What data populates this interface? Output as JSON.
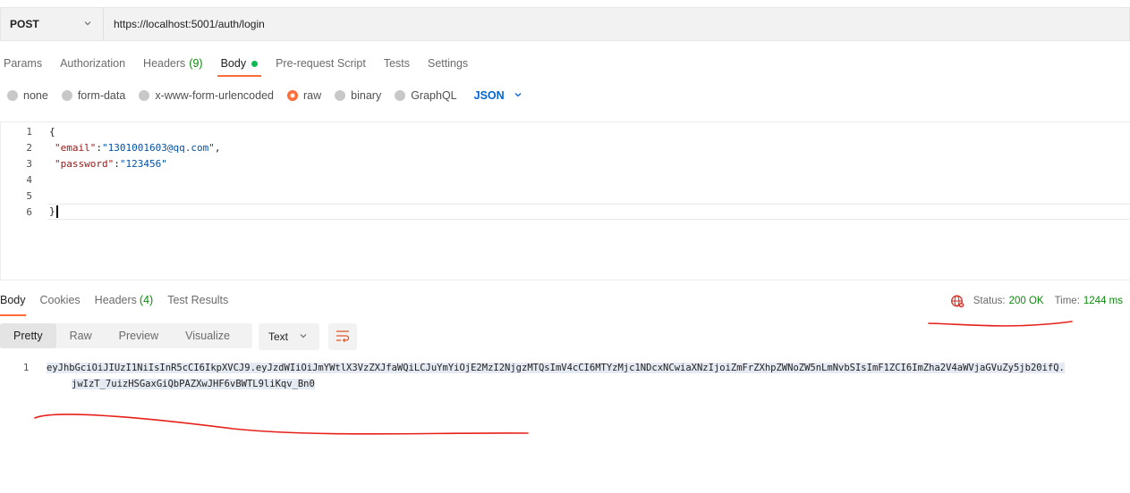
{
  "request": {
    "method": "POST",
    "url": "https://localhost:5001/auth/login"
  },
  "request_tabs": [
    {
      "label": "Params"
    },
    {
      "label": "Authorization"
    },
    {
      "label": "Headers",
      "count": "(9)"
    },
    {
      "label": "Body"
    },
    {
      "label": "Pre-request Script"
    },
    {
      "label": "Tests"
    },
    {
      "label": "Settings"
    }
  ],
  "body_types": [
    {
      "label": "none"
    },
    {
      "label": "form-data"
    },
    {
      "label": "x-www-form-urlencoded"
    },
    {
      "label": "raw"
    },
    {
      "label": "binary"
    },
    {
      "label": "GraphQL"
    }
  ],
  "body_format": "JSON",
  "editor": {
    "line_numbers": [
      "1",
      "2",
      "3",
      "4",
      "5",
      "6"
    ],
    "line1": "{",
    "email_key": "\"email\"",
    "email_colon": ":",
    "email_val": "\"1301001603@qq.com\"",
    "email_comma": ",",
    "password_key": "\"password\"",
    "password_colon": ":",
    "password_val": "\"123456\"",
    "line6": "}"
  },
  "response_tabs": [
    {
      "label": "Body"
    },
    {
      "label": "Cookies"
    },
    {
      "label": "Headers",
      "count": "(4)"
    },
    {
      "label": "Test Results"
    }
  ],
  "status": {
    "status_label": "Status:",
    "status_value": "200 OK",
    "time_label": "Time:",
    "time_value": "1244 ms"
  },
  "view_modes": [
    {
      "label": "Pretty"
    },
    {
      "label": "Raw"
    },
    {
      "label": "Preview"
    },
    {
      "label": "Visualize"
    }
  ],
  "response_format": "Text",
  "response": {
    "line_number": "1",
    "token_line1": "eyJhbGciOiJIUzI1NiIsInR5cCI6IkpXVCJ9.eyJzdWIiOiJmYWtlX3VzZXJfaWQiLCJuYmYiOjE2MzI2NjgzMTQsImV4cCI6MTYzMjc1NDcxNCwiaXNzIjoiZmFrZXhpZWNoZW5nLmNvbSIsImF1ZCI6ImZha2V4aWVjaGVuZy5jb20ifQ.",
    "token_line2": "jwIzT_7uizHSGaxGiQbPAZXwJHF6vBWTL9liKqv_Bn0"
  },
  "colors": {
    "accent": "#ff6c37",
    "success": "#0a8a0a",
    "link": "#0265d2",
    "annotation": "#e8201a"
  },
  "icons": {
    "method_chevron": "chevron-down-icon",
    "json_chevron": "chevron-down-icon",
    "globe": "globe-error-icon",
    "wrap": "wrap-lines-icon"
  }
}
